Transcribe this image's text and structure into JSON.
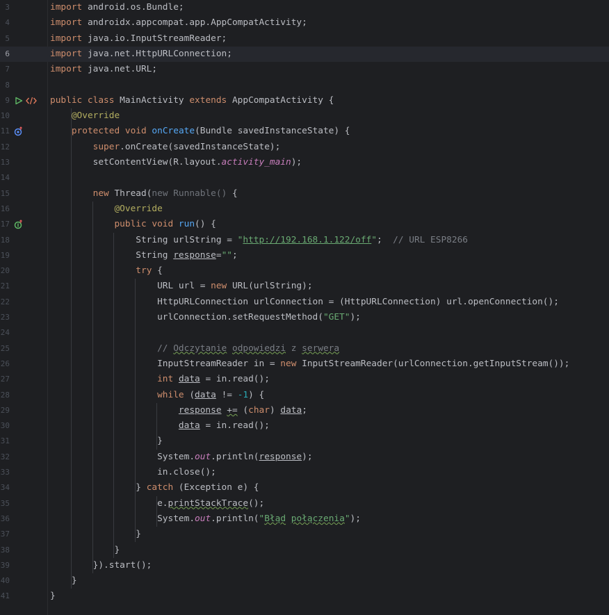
{
  "editor": {
    "current_line": 6,
    "lines": [
      {
        "n": "3",
        "parts": [
          [
            "kw",
            "import"
          ],
          [
            "",
            " android.os.Bundle;"
          ]
        ]
      },
      {
        "n": "4",
        "parts": [
          [
            "kw",
            "import"
          ],
          [
            "",
            " androidx.appcompat.app.AppCompatActivity;"
          ]
        ]
      },
      {
        "n": "5",
        "parts": [
          [
            "kw",
            "import"
          ],
          [
            "",
            " java.io.InputStreamReader;"
          ]
        ]
      },
      {
        "n": "6",
        "parts": [
          [
            "kw",
            "import"
          ],
          [
            "",
            " java.net.HttpURLConnection;"
          ]
        ]
      },
      {
        "n": "7",
        "parts": [
          [
            "kw",
            "import"
          ],
          [
            "",
            " java.net.URL;"
          ]
        ]
      },
      {
        "n": "8",
        "parts": []
      },
      {
        "n": "9",
        "parts": [
          [
            "kw",
            "public class"
          ],
          [
            "",
            " MainActivity "
          ],
          [
            "kw",
            "extends"
          ],
          [
            "",
            " AppCompatActivity {"
          ]
        ]
      },
      {
        "n": "10",
        "parts": [
          [
            "",
            "    "
          ],
          [
            "ann",
            "@Override"
          ]
        ]
      },
      {
        "n": "11",
        "parts": [
          [
            "",
            "    "
          ],
          [
            "kw",
            "protected void"
          ],
          [
            "",
            " "
          ],
          [
            "fn",
            "onCreate"
          ],
          [
            "",
            "(Bundle savedInstanceState) {"
          ]
        ]
      },
      {
        "n": "12",
        "parts": [
          [
            "",
            "        "
          ],
          [
            "kw",
            "super"
          ],
          [
            "",
            ".onCreate(savedInstanceState);"
          ]
        ]
      },
      {
        "n": "13",
        "parts": [
          [
            "",
            "        setContentView(R.layout."
          ],
          [
            "it",
            "activity_main"
          ],
          [
            "",
            ");"
          ]
        ]
      },
      {
        "n": "14",
        "parts": []
      },
      {
        "n": "15",
        "parts": [
          [
            "",
            "        "
          ],
          [
            "kw",
            "new"
          ],
          [
            "",
            " Thread("
          ],
          [
            "dim",
            "new Runnable()"
          ],
          [
            "",
            " {"
          ]
        ]
      },
      {
        "n": "16",
        "parts": [
          [
            "",
            "            "
          ],
          [
            "ann",
            "@Override"
          ]
        ]
      },
      {
        "n": "17",
        "parts": [
          [
            "",
            "            "
          ],
          [
            "kw",
            "public void"
          ],
          [
            "",
            " "
          ],
          [
            "fn",
            "run"
          ],
          [
            "",
            "() {"
          ]
        ]
      },
      {
        "n": "18",
        "parts": [
          [
            "",
            "                String urlString = "
          ],
          [
            "str",
            "\""
          ],
          [
            "str link",
            "http://192.168.1.122/off"
          ],
          [
            "str",
            "\""
          ],
          [
            "",
            ";  "
          ],
          [
            "cm",
            "// URL ESP8266"
          ]
        ]
      },
      {
        "n": "19",
        "parts": [
          [
            "",
            "                String "
          ],
          [
            "ul",
            "response"
          ],
          [
            "",
            "="
          ],
          [
            "str",
            "\"\""
          ],
          [
            "",
            ";"
          ]
        ]
      },
      {
        "n": "20",
        "parts": [
          [
            "",
            "                "
          ],
          [
            "kw",
            "try"
          ],
          [
            "",
            " {"
          ]
        ]
      },
      {
        "n": "21",
        "parts": [
          [
            "",
            "                    URL url = "
          ],
          [
            "kw",
            "new"
          ],
          [
            "",
            " URL(urlString);"
          ]
        ]
      },
      {
        "n": "22",
        "parts": [
          [
            "",
            "                    HttpURLConnection urlConnection = (HttpURLConnection) url.openConnection();"
          ]
        ]
      },
      {
        "n": "23",
        "parts": [
          [
            "",
            "                    urlConnection.setRequestMethod("
          ],
          [
            "str",
            "\"GET\""
          ],
          [
            "",
            ");"
          ]
        ]
      },
      {
        "n": "24",
        "parts": []
      },
      {
        "n": "25",
        "parts": [
          [
            "",
            "                    "
          ],
          [
            "cm",
            "// "
          ],
          [
            "cm wavy",
            "Odczytanie"
          ],
          [
            "cm",
            " "
          ],
          [
            "cm wavy",
            "odpowiedzi"
          ],
          [
            "cm",
            " z "
          ],
          [
            "cm wavy",
            "serwera"
          ]
        ]
      },
      {
        "n": "26",
        "parts": [
          [
            "",
            "                    InputStreamReader in = "
          ],
          [
            "kw",
            "new"
          ],
          [
            "",
            " InputStreamReader(urlConnection.getInputStream());"
          ]
        ]
      },
      {
        "n": "27",
        "parts": [
          [
            "",
            "                    "
          ],
          [
            "kw",
            "int"
          ],
          [
            "",
            " "
          ],
          [
            "ul",
            "data"
          ],
          [
            "",
            " = in.read();"
          ]
        ]
      },
      {
        "n": "28",
        "parts": [
          [
            "",
            "                    "
          ],
          [
            "kw",
            "while"
          ],
          [
            "",
            " ("
          ],
          [
            "ul",
            "data"
          ],
          [
            "",
            " != "
          ],
          [
            "num",
            "-1"
          ],
          [
            "",
            ") {"
          ]
        ]
      },
      {
        "n": "29",
        "parts": [
          [
            "",
            "                        "
          ],
          [
            "ul",
            "response"
          ],
          [
            "",
            " "
          ],
          [
            "wavy",
            "+="
          ],
          [
            "",
            " ("
          ],
          [
            "kw",
            "char"
          ],
          [
            "",
            ") "
          ],
          [
            "ul",
            "data"
          ],
          [
            "",
            ";"
          ]
        ]
      },
      {
        "n": "30",
        "parts": [
          [
            "",
            "                        "
          ],
          [
            "ul",
            "data"
          ],
          [
            "",
            " = in.read();"
          ]
        ]
      },
      {
        "n": "31",
        "parts": [
          [
            "",
            "                    }"
          ]
        ]
      },
      {
        "n": "32",
        "parts": [
          [
            "",
            "                    System."
          ],
          [
            "it",
            "out"
          ],
          [
            "",
            ".println("
          ],
          [
            "ul",
            "response"
          ],
          [
            "",
            ");"
          ]
        ]
      },
      {
        "n": "33",
        "parts": [
          [
            "",
            "                    in.close();"
          ]
        ]
      },
      {
        "n": "34",
        "parts": [
          [
            "",
            "                } "
          ],
          [
            "kw",
            "catch"
          ],
          [
            "",
            " (Exception e) {"
          ]
        ]
      },
      {
        "n": "35",
        "parts": [
          [
            "",
            "                    e."
          ],
          [
            "wavy",
            "printStackTrace"
          ],
          [
            "",
            "();"
          ]
        ]
      },
      {
        "n": "36",
        "parts": [
          [
            "",
            "                    System."
          ],
          [
            "it",
            "out"
          ],
          [
            "",
            ".println("
          ],
          [
            "str",
            "\""
          ],
          [
            "str wavy",
            "Błąd"
          ],
          [
            "str",
            " "
          ],
          [
            "str wavy",
            "połączenia"
          ],
          [
            "str",
            "\""
          ],
          [
            "",
            ");"
          ]
        ]
      },
      {
        "n": "37",
        "parts": [
          [
            "",
            "                }"
          ]
        ]
      },
      {
        "n": "38",
        "parts": [
          [
            "",
            "            }"
          ]
        ]
      },
      {
        "n": "39",
        "parts": [
          [
            "",
            "        }).start();"
          ]
        ]
      },
      {
        "n": "40",
        "parts": [
          [
            "",
            "    }"
          ]
        ]
      },
      {
        "n": "41",
        "parts": [
          [
            "",
            "}"
          ]
        ]
      }
    ],
    "gutter_icons": [
      {
        "line": "9",
        "icons": [
          "run-icon",
          "code-tag-icon"
        ]
      },
      {
        "line": "11",
        "icons": [
          "override-method-icon"
        ]
      },
      {
        "line": "17",
        "icons": [
          "implement-method-icon"
        ]
      }
    ],
    "colors": {
      "background": "#1e1f22",
      "keyword": "#cf8e6d",
      "string": "#6aab73",
      "number": "#2aacb8",
      "annotation": "#b3ae60",
      "function": "#56a8f5",
      "field": "#c77dbb",
      "comment": "#7a7e85",
      "text": "#bcbec4"
    }
  }
}
